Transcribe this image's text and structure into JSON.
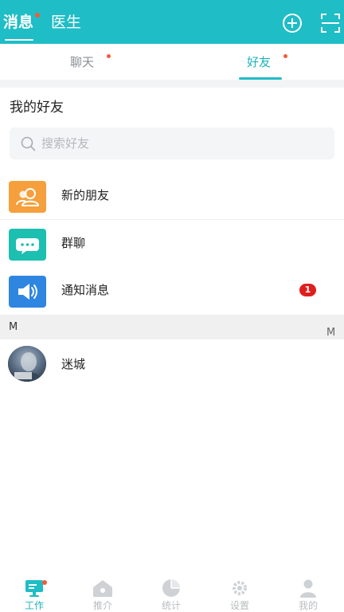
{
  "header": {
    "tabs": [
      {
        "label": "消息",
        "active": true,
        "dot": true
      },
      {
        "label": "医生",
        "active": false
      }
    ],
    "icons": [
      "add-circle-icon",
      "scan-icon"
    ]
  },
  "subtabs": [
    {
      "label": "聊天",
      "dot": true,
      "active": false
    },
    {
      "label": "好友",
      "dot": true,
      "active": true
    }
  ],
  "friends": {
    "title": "我的好友",
    "search_placeholder": "搜索好友",
    "entries": [
      {
        "label": "新的朋友",
        "icon": "new-friend-icon",
        "color": "#f5a03c"
      },
      {
        "label": "群聊",
        "icon": "group-chat-icon",
        "color": "#1cbfb0"
      },
      {
        "label": "通知消息",
        "icon": "notification-icon",
        "color": "#2e86e0",
        "badge": "1"
      }
    ],
    "index_letter": "M",
    "side_index": "M",
    "contacts": [
      {
        "name": "迷城"
      }
    ]
  },
  "bottom_nav": [
    {
      "label": "工作",
      "icon": "work-icon",
      "active": true,
      "dot": true
    },
    {
      "label": "推介",
      "icon": "recommend-icon",
      "active": false
    },
    {
      "label": "统计",
      "icon": "stats-icon",
      "active": false
    },
    {
      "label": "设置",
      "icon": "settings-icon",
      "active": false
    },
    {
      "label": "我的",
      "icon": "profile-icon",
      "active": false
    }
  ],
  "colors": {
    "primary": "#1fbdc6",
    "accent_dot": "#f25b38",
    "badge": "#e01e1e"
  }
}
